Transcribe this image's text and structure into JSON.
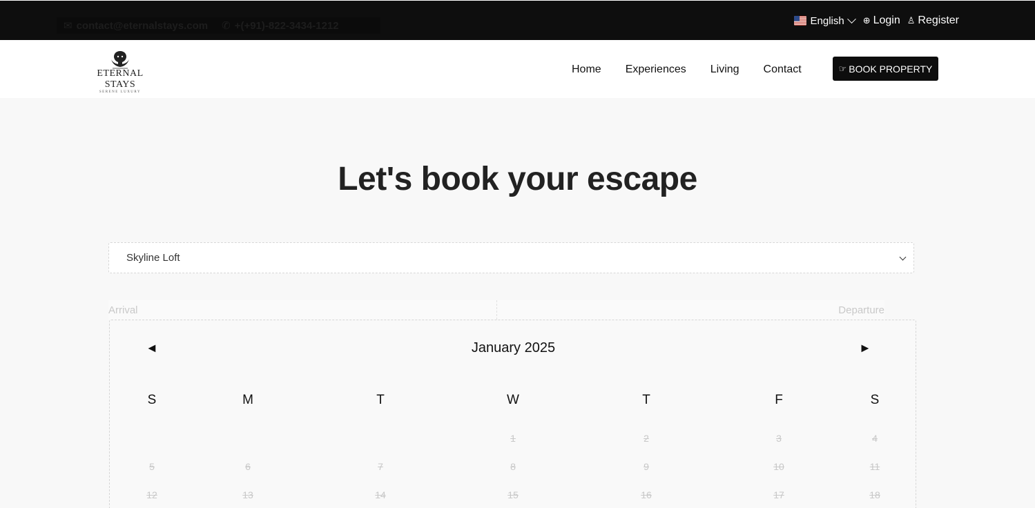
{
  "topbar": {
    "email": "contact@eternalstays.com",
    "phone": "+(+91)-822-3434-1212",
    "language": "English",
    "login": "Login",
    "register": "Register"
  },
  "brand": {
    "name": "ETERNAL STAYS",
    "tagline": "SERENE LUXURY"
  },
  "nav": {
    "items": [
      "Home",
      "Experiences",
      "Living",
      "Contact"
    ],
    "book_button": "BOOK PROPERTY"
  },
  "main": {
    "title": "Let's book your escape",
    "property_selected": "Skyline Loft",
    "arrival_label": "Arrival",
    "departure_label": "Departure"
  },
  "calendar": {
    "month": "January 2025",
    "prev": "◄",
    "next": "►",
    "weekdays": [
      "S",
      "M",
      "T",
      "W",
      "T",
      "F",
      "S"
    ],
    "weeks": [
      [
        "",
        "",
        "",
        "1",
        "2",
        "3",
        "4"
      ],
      [
        "5",
        "6",
        "7",
        "8",
        "9",
        "10",
        "11"
      ],
      [
        "12",
        "13",
        "14",
        "15",
        "16",
        "17",
        "18"
      ]
    ]
  },
  "colors": {
    "topbar_bg": "#0e0e0e",
    "button_bg": "#0d0d0d",
    "page_bg": "#f8f8f8",
    "disabled_day": "#c8c8c8"
  }
}
